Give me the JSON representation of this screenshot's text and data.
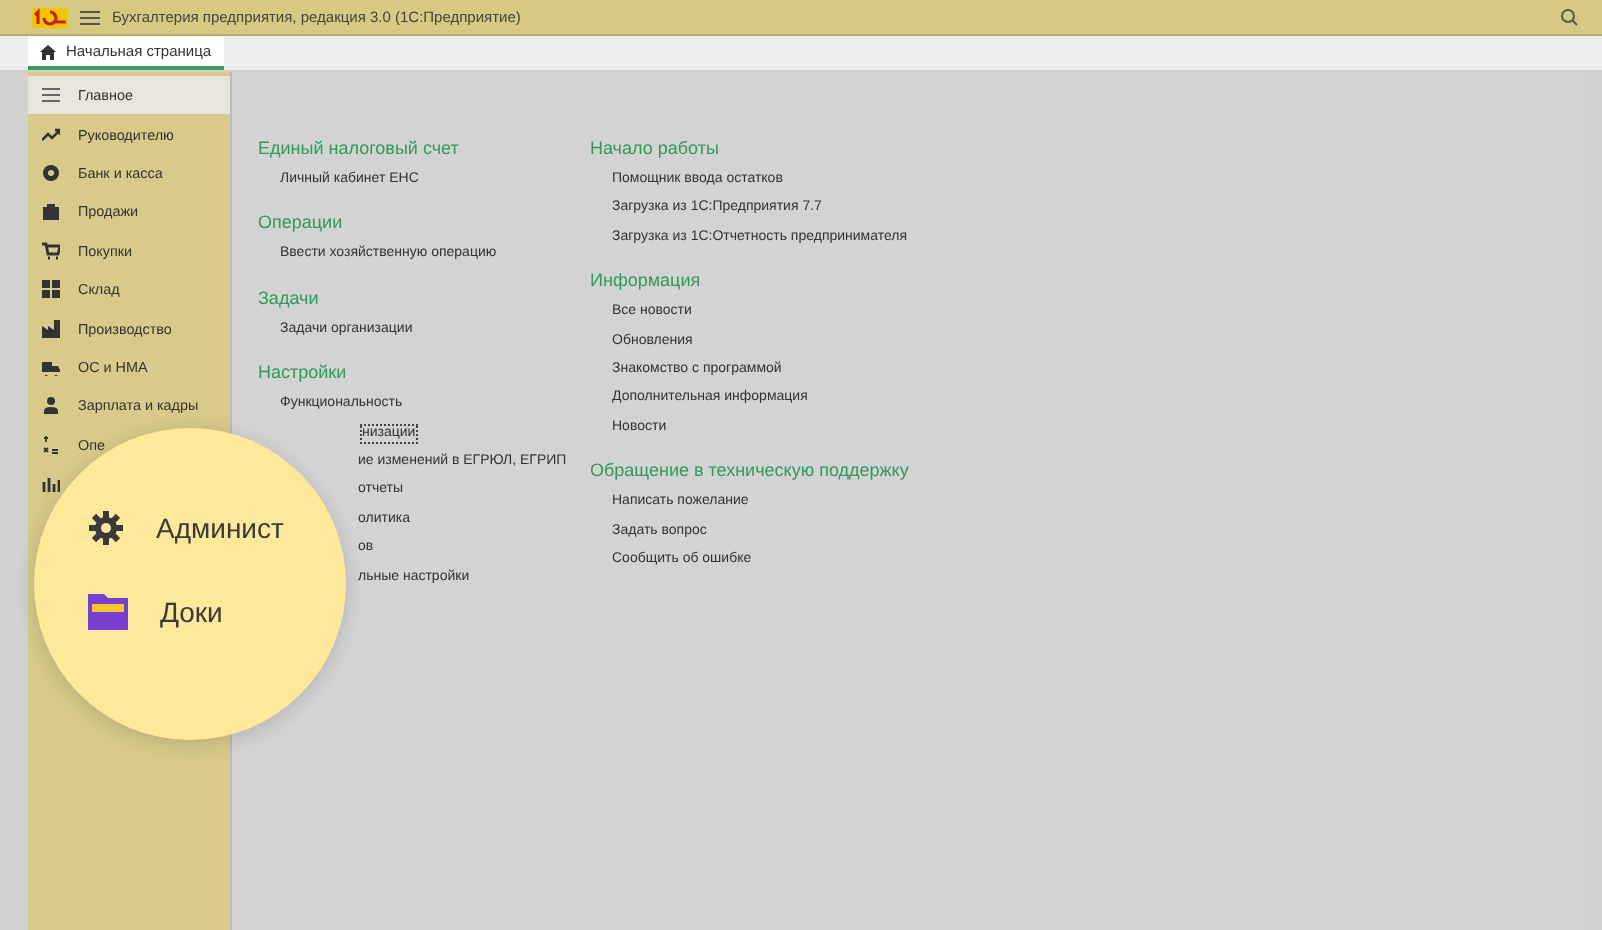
{
  "window": {
    "title": "Бухгалтерия предприятия, редакция 3.0  (1С:Предприятие)"
  },
  "tabs": [
    {
      "label": "Начальная страница",
      "selected": true
    }
  ],
  "sidebar": {
    "items": [
      {
        "label": "Главное",
        "kind": "menu",
        "selected": true
      },
      {
        "label": "Руководителю",
        "kind": "trend",
        "selected": false
      },
      {
        "label": "Банк и касса",
        "kind": "coin",
        "selected": false
      },
      {
        "label": "Продажи",
        "kind": "bag",
        "selected": false
      },
      {
        "label": "Покупки",
        "kind": "cart",
        "selected": false
      },
      {
        "label": "Склад",
        "kind": "grid",
        "selected": false
      },
      {
        "label": "Производство",
        "kind": "factory",
        "selected": false
      },
      {
        "label": "ОС и НМА",
        "kind": "truck",
        "selected": false
      },
      {
        "label": "Зарплата и кадры",
        "kind": "person",
        "selected": false
      },
      {
        "label": "Опе",
        "kind": "ops",
        "selected": false
      },
      {
        "kind": "bars",
        "selected": false
      }
    ]
  },
  "columns": [
    [
      {
        "title": "Единый налоговый счет",
        "links": [
          {
            "label": "Личный кабинет ЕНС",
            "kind": "link",
            "focused": false
          }
        ]
      },
      {
        "title": "Операции",
        "links": [
          {
            "label": "Ввести хозяйственную операцию",
            "kind": "link",
            "focused": false
          }
        ]
      },
      {
        "title": "Задачи",
        "links": [
          {
            "label": "Задачи организации",
            "kind": "link",
            "focused": false
          }
        ]
      },
      {
        "title": "Настройки",
        "links": [
          {
            "label": "Функциональность",
            "kind": "link",
            "focused": false
          },
          {
            "label": "низации",
            "kind": "covered",
            "focused": true
          },
          {
            "label": "ие изменений в ЕГРЮЛ, ЕГРИП",
            "kind": "covered",
            "focused": false
          },
          {
            "label": "отчеты",
            "kind": "covered",
            "focused": false
          },
          {
            "label": "олитика",
            "kind": "covered",
            "focused": false
          },
          {
            "label": "ов",
            "kind": "covered",
            "focused": false
          },
          {
            "label": "льные настройки",
            "kind": "covered",
            "focused": false
          }
        ]
      }
    ],
    [
      {
        "title": "Начало работы",
        "links": [
          {
            "label": "Помощник ввода остатков",
            "kind": "link",
            "focused": false
          },
          {
            "label": "Загрузка из 1С:Предприятия 7.7",
            "kind": "link",
            "focused": false
          },
          {
            "label": "Загрузка из 1С:Отчетность предпринимателя",
            "kind": "link",
            "focused": false
          }
        ]
      },
      {
        "title": "Информация",
        "links": [
          {
            "label": "Все новости",
            "kind": "link",
            "focused": false
          },
          {
            "label": "Обновления",
            "kind": "link",
            "focused": false
          },
          {
            "label": "Знакомство с программой",
            "kind": "link",
            "focused": false
          },
          {
            "label": "Дополнительная информация",
            "kind": "link",
            "focused": false
          },
          {
            "label": "Новости",
            "kind": "link",
            "focused": false
          }
        ]
      },
      {
        "title": "Обращение в техническую поддержку",
        "links": [
          {
            "label": "Написать пожелание",
            "kind": "link",
            "focused": false
          },
          {
            "label": "Задать вопрос",
            "kind": "link",
            "focused": false
          },
          {
            "label": "Сообщить об ошибке",
            "kind": "link",
            "focused": false
          }
        ]
      }
    ]
  ],
  "magnifier": {
    "items": [
      {
        "label": "Админист",
        "kind": "gear"
      },
      {
        "label": "Доки",
        "kind": "folder"
      }
    ]
  }
}
